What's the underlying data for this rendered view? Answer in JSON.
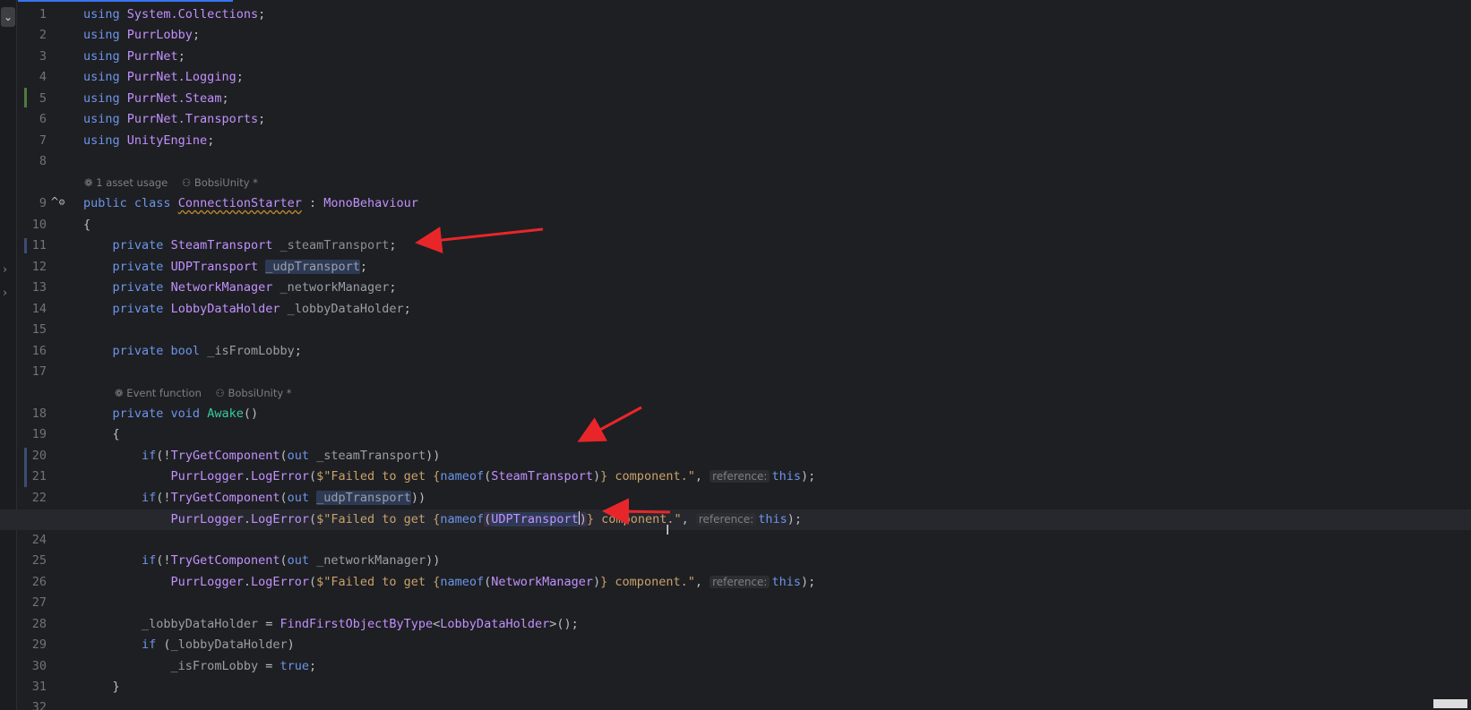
{
  "editor": {
    "collapse_icon": "chevron-down-icon",
    "lens_class": {
      "usage": "1 asset usage",
      "author": "BobsiUnity *"
    },
    "lens_awake": {
      "usage": "Event function",
      "author": "BobsiUnity *"
    },
    "inlay_label": "reference:",
    "line_numbers": [
      "1",
      "2",
      "3",
      "4",
      "5",
      "6",
      "7",
      "8",
      "9",
      "10",
      "11",
      "12",
      "13",
      "14",
      "15",
      "16",
      "17",
      "18",
      "19",
      "20",
      "21",
      "22",
      "23",
      "24",
      "25",
      "26",
      "27",
      "28",
      "29",
      "30",
      "31",
      "32"
    ],
    "code": {
      "l1_kw": "using",
      "l1_ns": "System.Collections",
      "l2_kw": "using",
      "l2_ns": "PurrLobby",
      "l3_kw": "using",
      "l3_ns": "PurrNet",
      "l4_kw": "using",
      "l4_ns": "PurrNet.Logging",
      "l5_kw": "using",
      "l5_ns": "PurrNet.Steam",
      "l6_kw": "using",
      "l6_ns": "PurrNet.Transports",
      "l7_kw": "using",
      "l7_ns": "UnityEngine",
      "l9_kw": "public class",
      "l9_name": "ConnectionStarter",
      "l9_sep": " : ",
      "l9_base": "MonoBehaviour",
      "l10": "{",
      "l11_kw": "private",
      "l11_type": "SteamTransport",
      "l11_field": "_steamTransport",
      "l12_kw": "private",
      "l12_type": "UDPTransport",
      "l12_field": "_udpTransport",
      "l13_kw": "private",
      "l13_type": "NetworkManager",
      "l13_field": "_networkManager",
      "l14_kw": "private",
      "l14_type": "LobbyDataHolder",
      "l14_field": "_lobbyDataHolder",
      "l16_kw": "private bool",
      "l16_field": "_isFromLobby",
      "l18_kw": "private void",
      "l18_fn": "Awake",
      "l19": "{",
      "l20_kw": "if",
      "l20_fn": "TryGetComponent",
      "l20_out": "out",
      "l20_field": "_steamTransport",
      "l21_cls": "PurrLogger",
      "l21_fn": "LogError",
      "l21_str": "$\"Failed to get {",
      "l21_nameof": "nameof",
      "l21_type": "SteamTransport",
      "l21_str2": "} component.\"",
      "l21_this": "this",
      "l22_kw": "if",
      "l22_fn": "TryGetComponent",
      "l22_out": "out",
      "l22_field": "_udpTransport",
      "l23_cls": "PurrLogger",
      "l23_fn": "LogError",
      "l23_str": "$\"Failed to get {",
      "l23_nameof": "nameof",
      "l23_type": "UDPTransport",
      "l23_str2": "} component.\"",
      "l23_this": "this",
      "l25_kw": "if",
      "l25_fn": "TryGetComponent",
      "l25_out": "out",
      "l25_field": "_networkManager",
      "l26_cls": "PurrLogger",
      "l26_fn": "LogError",
      "l26_str": "$\"Failed to get {",
      "l26_nameof": "nameof",
      "l26_type": "NetworkManager",
      "l26_str2": "} component.\"",
      "l26_this": "this",
      "l28_field": "_lobbyDataHolder",
      "l28_fn": "FindFirstObjectByType",
      "l28_type": "LobbyDataHolder",
      "l29_kw": "if",
      "l29_field": "_lobbyDataHolder",
      "l30_field": "_isFromLobby",
      "l30_val": "true",
      "l31": "}"
    }
  },
  "annotations": {
    "arrow_color": "#e8262a"
  },
  "colors": {
    "background": "#1e1f22",
    "keyword": "#6c95eb",
    "type": "#c191ff",
    "method": "#39cc9b",
    "string": "#c9a26d",
    "line_number": "#6f737a"
  }
}
